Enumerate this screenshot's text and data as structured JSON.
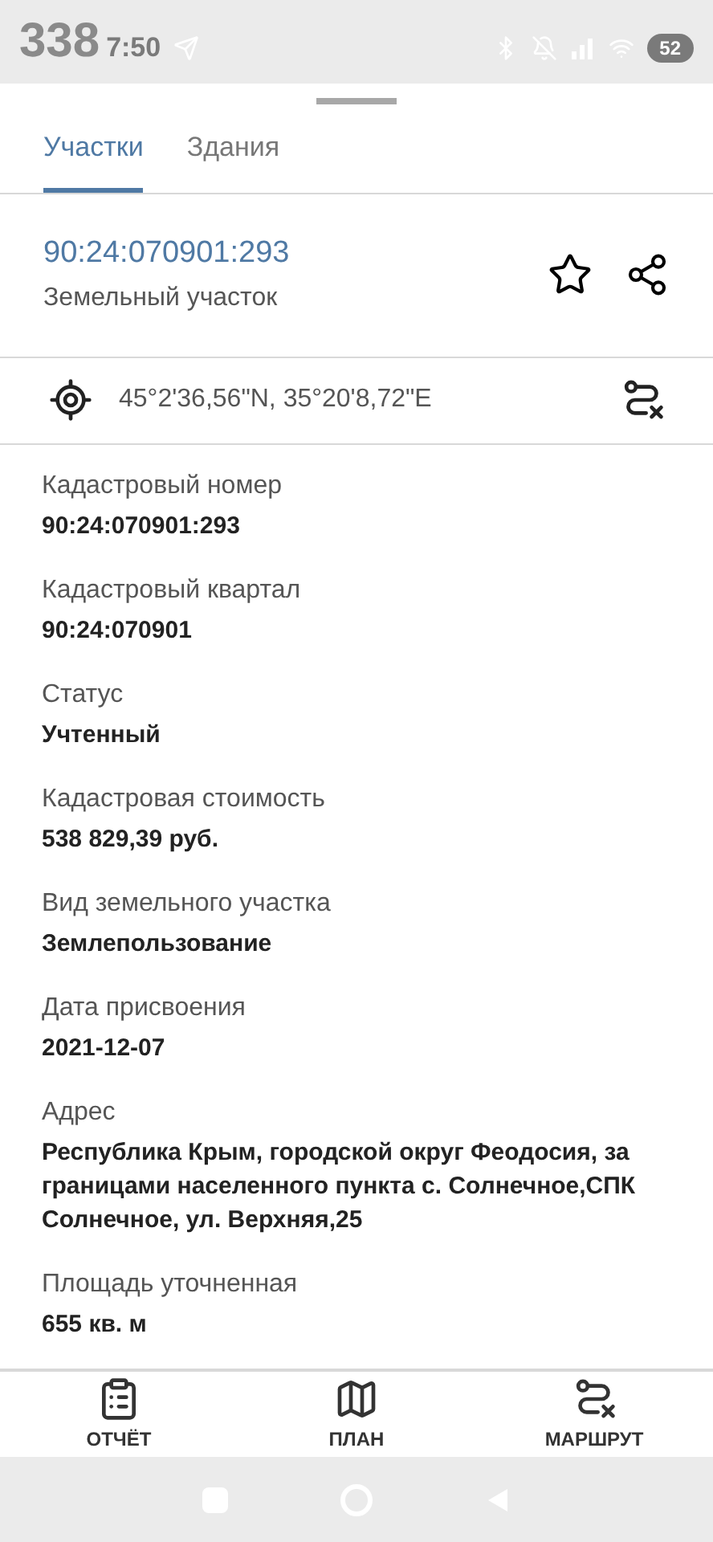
{
  "status_bar": {
    "overlay_number": "338",
    "time": "7:50",
    "battery": "52"
  },
  "tabs": [
    {
      "label": "Участки",
      "selected": true
    },
    {
      "label": "Здания",
      "selected": false
    }
  ],
  "header": {
    "number": "90:24:070901:293",
    "type": "Земельный участок"
  },
  "coordinates": "45°2'36,56\"N, 35°20'8,72\"E",
  "fields": [
    {
      "label": "Кадастровый номер",
      "value": "90:24:070901:293"
    },
    {
      "label": "Кадастровый квартал",
      "value": "90:24:070901"
    },
    {
      "label": "Статус",
      "value": "Учтенный"
    },
    {
      "label": "Кадастровая стоимость",
      "value": "538 829,39 руб."
    },
    {
      "label": "Вид земельного участка",
      "value": "Землепользование"
    },
    {
      "label": "Дата присвоения",
      "value": "2021-12-07"
    },
    {
      "label": "Адрес",
      "value": "Республика Крым, городской округ Феодосия, за границами населенного пункта с. Солнечное,СПК Солнечное, ул. Верхняя,25"
    },
    {
      "label": "Площадь уточненная",
      "value": "655 кв. м"
    }
  ],
  "bottom_nav": [
    {
      "kind": "report",
      "label": "ОТЧЁТ"
    },
    {
      "kind": "plan",
      "label": "ПЛАН"
    },
    {
      "kind": "route",
      "label": "МАРШРУТ"
    }
  ]
}
